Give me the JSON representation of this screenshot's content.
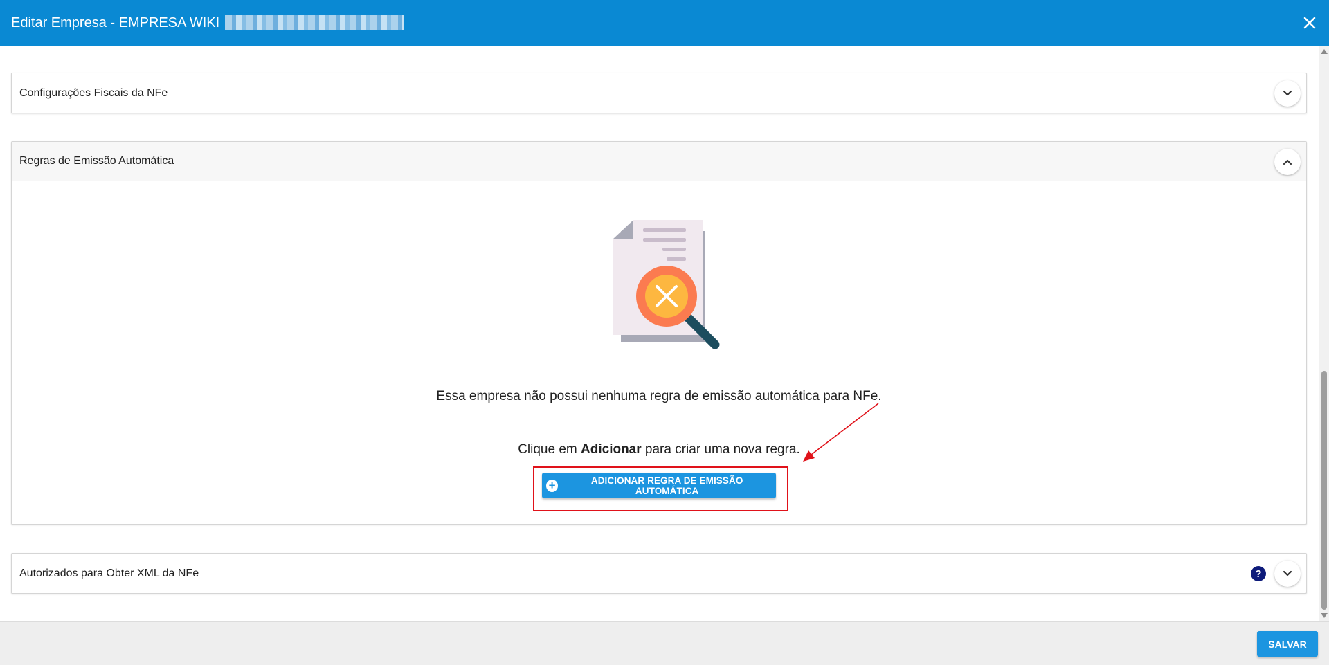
{
  "header": {
    "title": "Editar Empresa - EMPRESA WIKI",
    "close_icon": "close-icon",
    "color": "#0a89d3"
  },
  "panels": {
    "fiscal": {
      "title": "Configurações Fiscais da NFe",
      "state": "collapsed"
    },
    "rules": {
      "title": "Regras de Emissão Automática",
      "state": "expanded",
      "empty_message": "Essa empresa não possui nenhuma regra de emissão automática para NFe.",
      "hint_before": "Clique em ",
      "hint_bold": "Adicionar",
      "hint_after": " para criar uma nova regra.",
      "add_button_label": "ADICIONAR REGRA DE EMISSÃO AUTOMÁTICA",
      "illustration_icon": "document-search-not-found-icon"
    },
    "authorized": {
      "title": "Autorizados para Obter XML da NFe",
      "state": "collapsed",
      "help_icon_label": "?"
    }
  },
  "footer": {
    "save_label": "SALVAR"
  },
  "annotation": {
    "box_color": "#e0121a",
    "arrow_color": "#e0121a"
  },
  "colors": {
    "button": "#1c95e0"
  }
}
